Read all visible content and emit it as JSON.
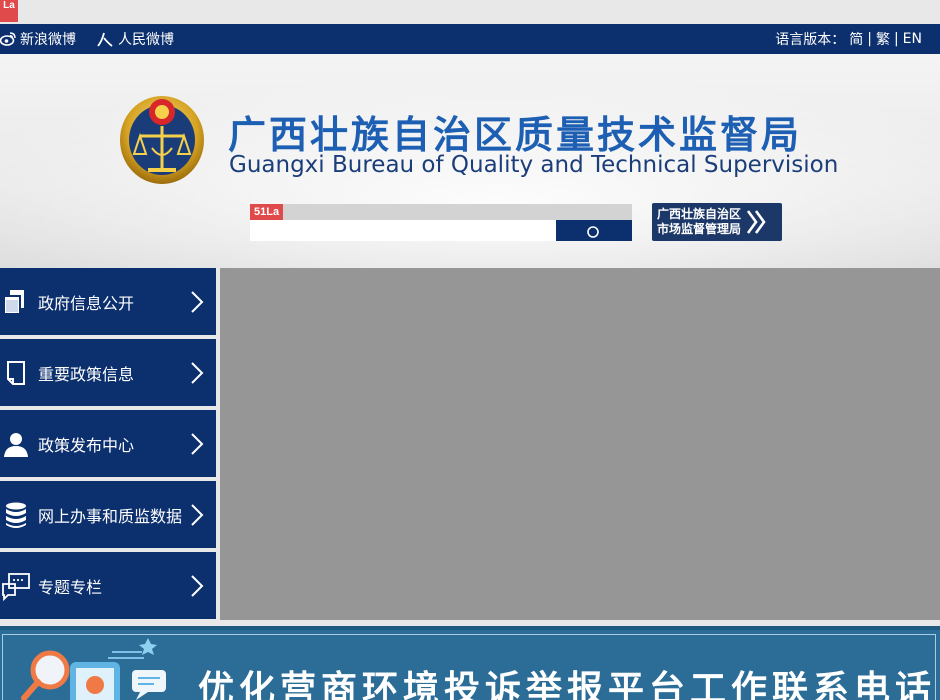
{
  "tracker_badge": {
    "line1": "",
    "line2": "La"
  },
  "topbar": {
    "links": [
      {
        "label": "新浪微博",
        "icon": "weibo-icon"
      },
      {
        "label": "人民微博",
        "icon": "people-weibo-icon"
      }
    ],
    "lang_label": "语言版本：",
    "lang_options": [
      "简",
      "繁",
      "EN"
    ],
    "separator": "|"
  },
  "header": {
    "title_cn": "广西壮族自治区质量技术监督局",
    "title_en": "Guangxi Bureau of Quality and Technical Supervision"
  },
  "search": {
    "counter_label": "51La",
    "placeholder": "",
    "button_icon": "search-icon"
  },
  "sa_button": {
    "line1": "广西壮族自治区",
    "line2": "市场监督管理局"
  },
  "menu": [
    {
      "label": "政府信息公开",
      "icon": "document-icon"
    },
    {
      "label": "重要政策信息",
      "icon": "page-icon"
    },
    {
      "label": "政策发布中心",
      "icon": "person-icon"
    },
    {
      "label": "网上办事和质监数据",
      "icon": "database-icon"
    },
    {
      "label": "专题专栏",
      "icon": "chat-icon"
    }
  ],
  "banner": {
    "text": "优化营商环境投诉举报平台工作联系电话"
  },
  "colors": {
    "navy": "#0c2f6e",
    "title_blue": "#1d5fb3",
    "banner_blue": "#2b6d97",
    "slider_gray": "#969696"
  }
}
